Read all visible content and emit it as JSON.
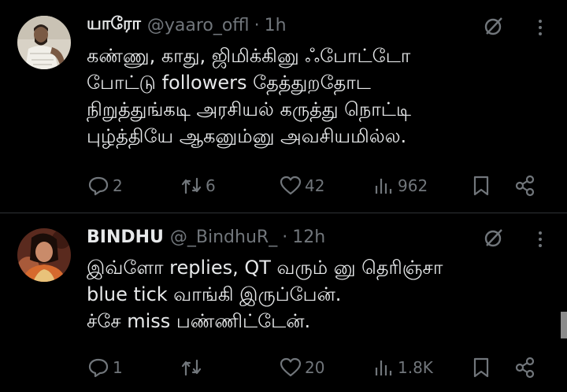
{
  "colors": {
    "background": "#000000",
    "text": "#e7e9ea",
    "muted": "#71767b",
    "divider": "#2f3336"
  },
  "tweets": [
    {
      "name": "யாரோ",
      "handle": "@yaaro_offl",
      "dot": "·",
      "time": "1h",
      "lines": [
        "கண்ணு, காது, ஜிமிக்கினு ஃபோட்டோ",
        "போட்டு followers தேத்துறதோட",
        "நிறுத்துங்கடி அரசியல் கருத்து நொட்டி",
        "புழ்த்தியே ஆகனும்னு அவசியமில்ல."
      ],
      "replies": "2",
      "retweets": "6",
      "likes": "42",
      "views": "962"
    },
    {
      "name": "BINDHU",
      "handle": "@_BindhuR_",
      "dot": "·",
      "time": "12h",
      "lines": [
        "இவ்ளோ replies,  QT வரும் னு தெரிஞ்சா",
        "blue tick வாங்கி இருப்பேன்.",
        "ச்சே miss பண்ணிட்டேன்."
      ],
      "replies": "1",
      "retweets": "",
      "likes": "20",
      "views": "1.8K"
    }
  ],
  "icons": [
    "grok-icon",
    "more-icon",
    "reply-icon",
    "retweet-icon",
    "like-icon",
    "views-icon",
    "bookmark-icon",
    "share-icon"
  ]
}
